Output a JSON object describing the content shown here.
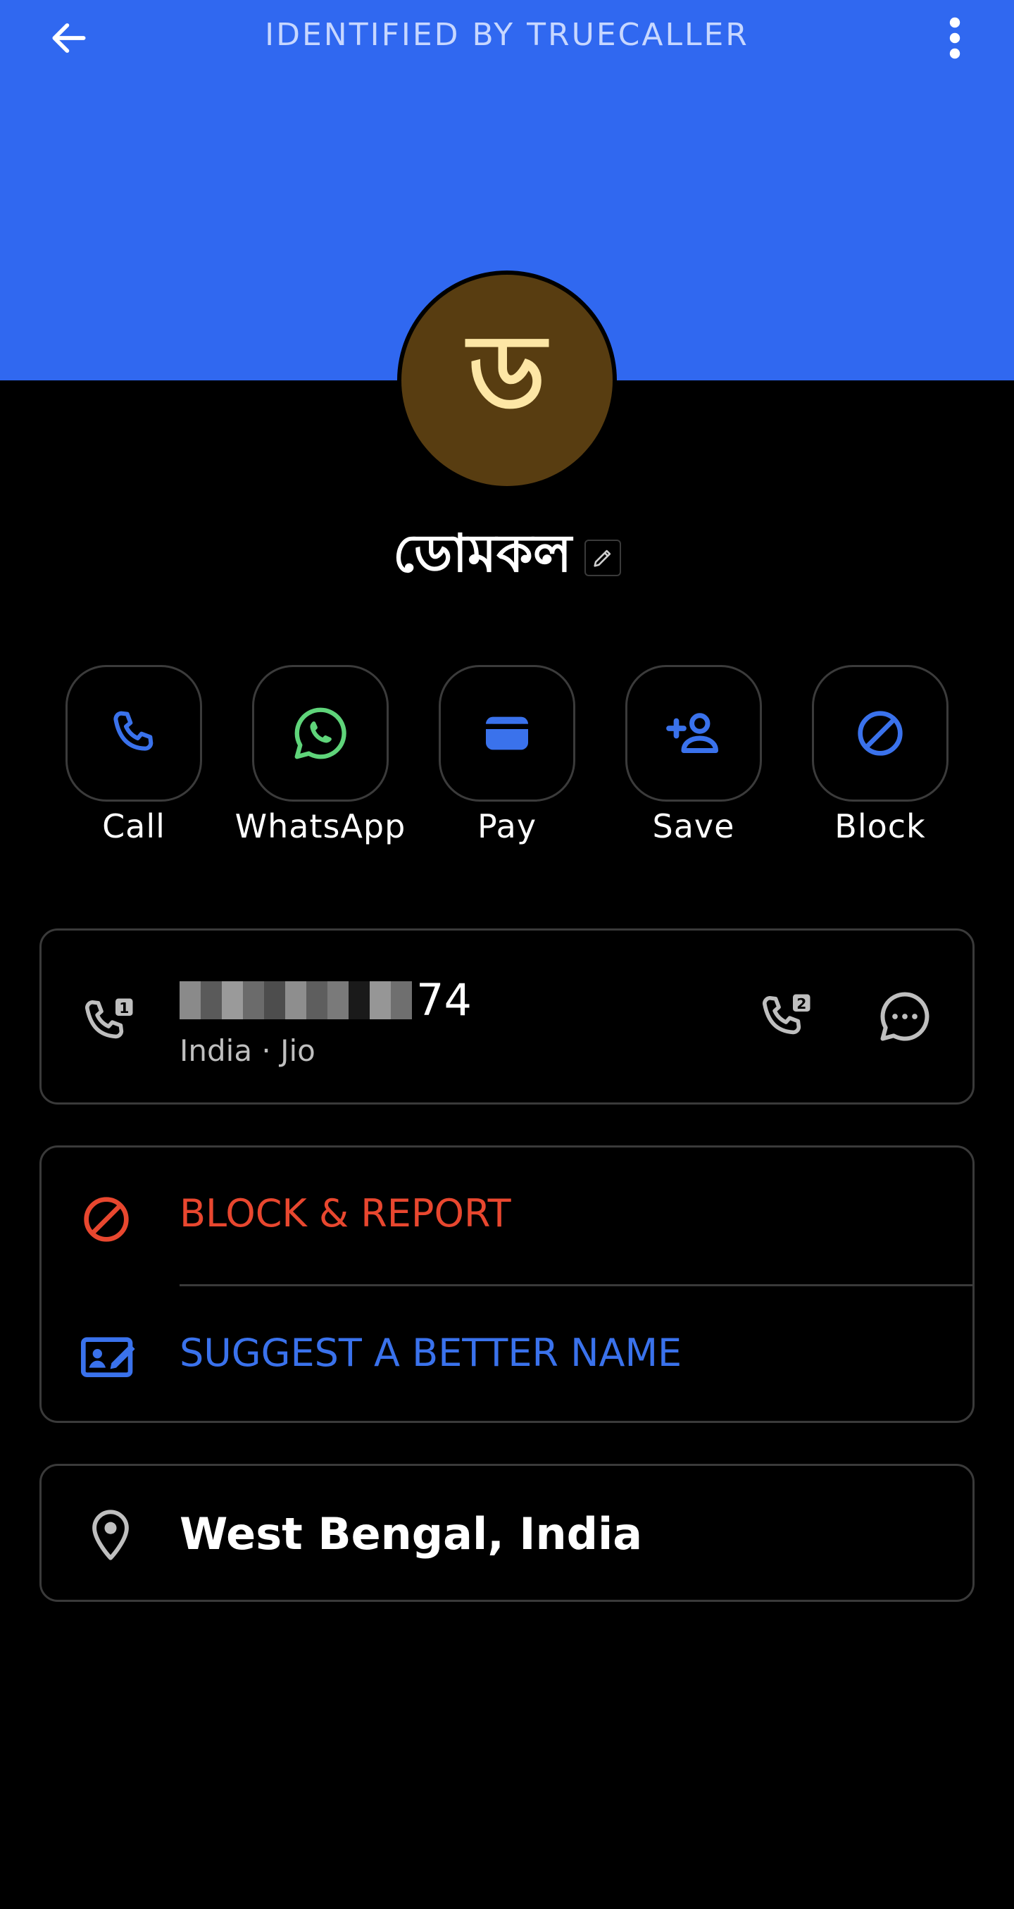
{
  "header": {
    "title": "IDENTIFIED BY TRUECALLER",
    "back_icon": "arrow-left-icon",
    "more_icon": "more-vertical-icon",
    "background_color": "#3068f0"
  },
  "contact": {
    "avatar_letter": "ড",
    "avatar_color": "#583d11",
    "name": "ডোমকল"
  },
  "actions": [
    {
      "label": "Call",
      "icon": "phone-icon"
    },
    {
      "label": "WhatsApp",
      "icon": "whatsapp-icon"
    },
    {
      "label": "Pay",
      "icon": "wallet-icon"
    },
    {
      "label": "Save",
      "icon": "add-person-icon"
    },
    {
      "label": "Block",
      "icon": "block-icon"
    }
  ],
  "phone": {
    "number_visible_suffix": "74",
    "carrier": "India · Jio",
    "sim1_icon": "phone-sim1-icon",
    "sim2_icon": "phone-sim2-icon",
    "message_icon": "message-icon"
  },
  "options": {
    "block_report": "BLOCK & REPORT",
    "suggest_name": "SUGGEST A BETTER NAME"
  },
  "location": {
    "text": "West Bengal, India",
    "icon": "location-pin-icon"
  },
  "colors": {
    "accent_blue": "#3a72ec",
    "danger_red": "#e8472f",
    "whatsapp_green": "#5fd47a"
  }
}
